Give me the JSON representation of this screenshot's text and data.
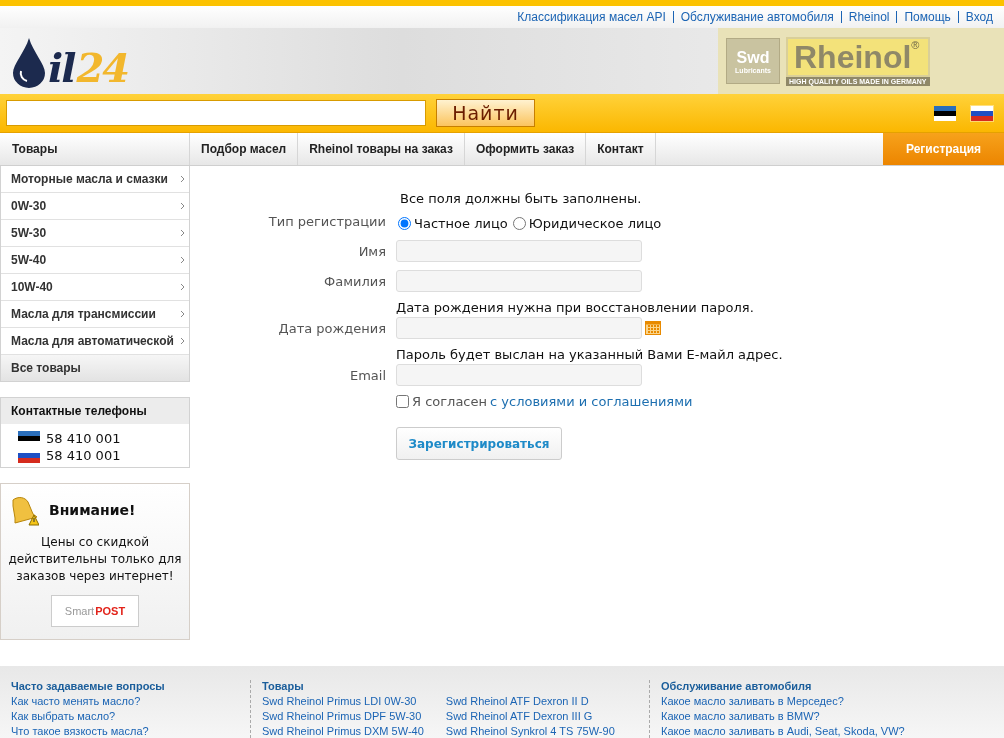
{
  "top_links": [
    "Классификация масел API",
    "Обслуживание автомобиля",
    "Rheinol",
    "Помощь",
    "Вход"
  ],
  "logo": {
    "letter": "il",
    "number": "24"
  },
  "brand": {
    "badge": "Swd",
    "badge_sub": "Lubricants",
    "name": "Rheinol",
    "mark": "®",
    "tagline": "HIGH QUALITY OILS MADE IN GERMANY"
  },
  "search": {
    "button": "Найти"
  },
  "languages": [
    {
      "kind": "estonian",
      "selected": false
    },
    {
      "kind": "russian",
      "selected": true
    }
  ],
  "nav": {
    "catalog": "Товары",
    "items": [
      {
        "label": "Подбор масел",
        "selected": false
      },
      {
        "label": "Rheinol товары на заказ",
        "selected": false
      },
      {
        "label": "Оформить заказ",
        "selected": false
      },
      {
        "label": "Контакт",
        "selected": false
      }
    ],
    "register": {
      "label": "Регистрация",
      "selected": true
    }
  },
  "sidebar": {
    "categories": [
      {
        "label": "Моторные масла и смазки",
        "kind": "sub"
      },
      {
        "label": "0W-30",
        "kind": "sub"
      },
      {
        "label": "5W-30",
        "kind": "sub"
      },
      {
        "label": "5W-40",
        "kind": "sub"
      },
      {
        "label": "10W-40",
        "kind": "sub"
      },
      {
        "label": "Масла для трансмиссии",
        "kind": "sub"
      },
      {
        "label": "Масла для автоматической",
        "kind": "sub"
      },
      {
        "label": "Все товары",
        "kind": "all"
      }
    ],
    "contacts": {
      "title": "Контактные телефоны",
      "phones": [
        {
          "kind": "estonian",
          "number": "58 410 001"
        },
        {
          "kind": "russian",
          "number": "58 410 001"
        }
      ]
    },
    "notice": {
      "title": "Внимание!",
      "text": "Цены со скидкой действительны только для заказов через интернет!",
      "logo_left": "Smart",
      "logo_right": "POST"
    }
  },
  "registration": {
    "intro": "Все поля должны быть заполнены.",
    "type_label": "Тип регистрации",
    "types": [
      {
        "label": "Частное лицо",
        "selected": true
      },
      {
        "label": "Юридическое лицо",
        "selected": false
      }
    ],
    "fields": [
      {
        "label": "Имя",
        "kind": "text"
      },
      {
        "label": "Фамилия",
        "kind": "text"
      },
      {
        "label": "Дата рождения",
        "kind": "date",
        "hint": "Дата рождения нужна при восстановлении пароля."
      },
      {
        "label": "Email",
        "kind": "text",
        "hint": "Пароль будет выслан на указанный Вами E-майл адрес."
      }
    ],
    "agree": {
      "checked": false,
      "text": "Я согласен",
      "link": "с условиями и соглашениями"
    },
    "submit": "Зарегистрироваться"
  },
  "footer": [
    {
      "title": "Часто задаваемые вопросы",
      "columns": [
        [
          "Как часто менять масло?",
          "Как выбрать масло?",
          "Что такое вязкость масла?"
        ]
      ]
    },
    {
      "title": "Товары",
      "columns": [
        [
          "Swd Rheinol Primus LDI 0W-30",
          "Swd Rheinol Primus DPF 5W-30",
          "Swd Rheinol Primus DXM 5W-40"
        ],
        [
          "Swd Rheinol ATF Dexron II D",
          "Swd Rheinol ATF Dexron III G",
          "Swd Rheinol Synkrol 4 TS 75W-90"
        ]
      ]
    },
    {
      "title": "Обслуживание автомобиля",
      "columns": [
        [
          "Какое масло заливать в Мерседес?",
          "Какое масло заливать в BMW?",
          "Какое масло заливать в Audi, Seat, Skoda, VW?"
        ]
      ]
    }
  ]
}
